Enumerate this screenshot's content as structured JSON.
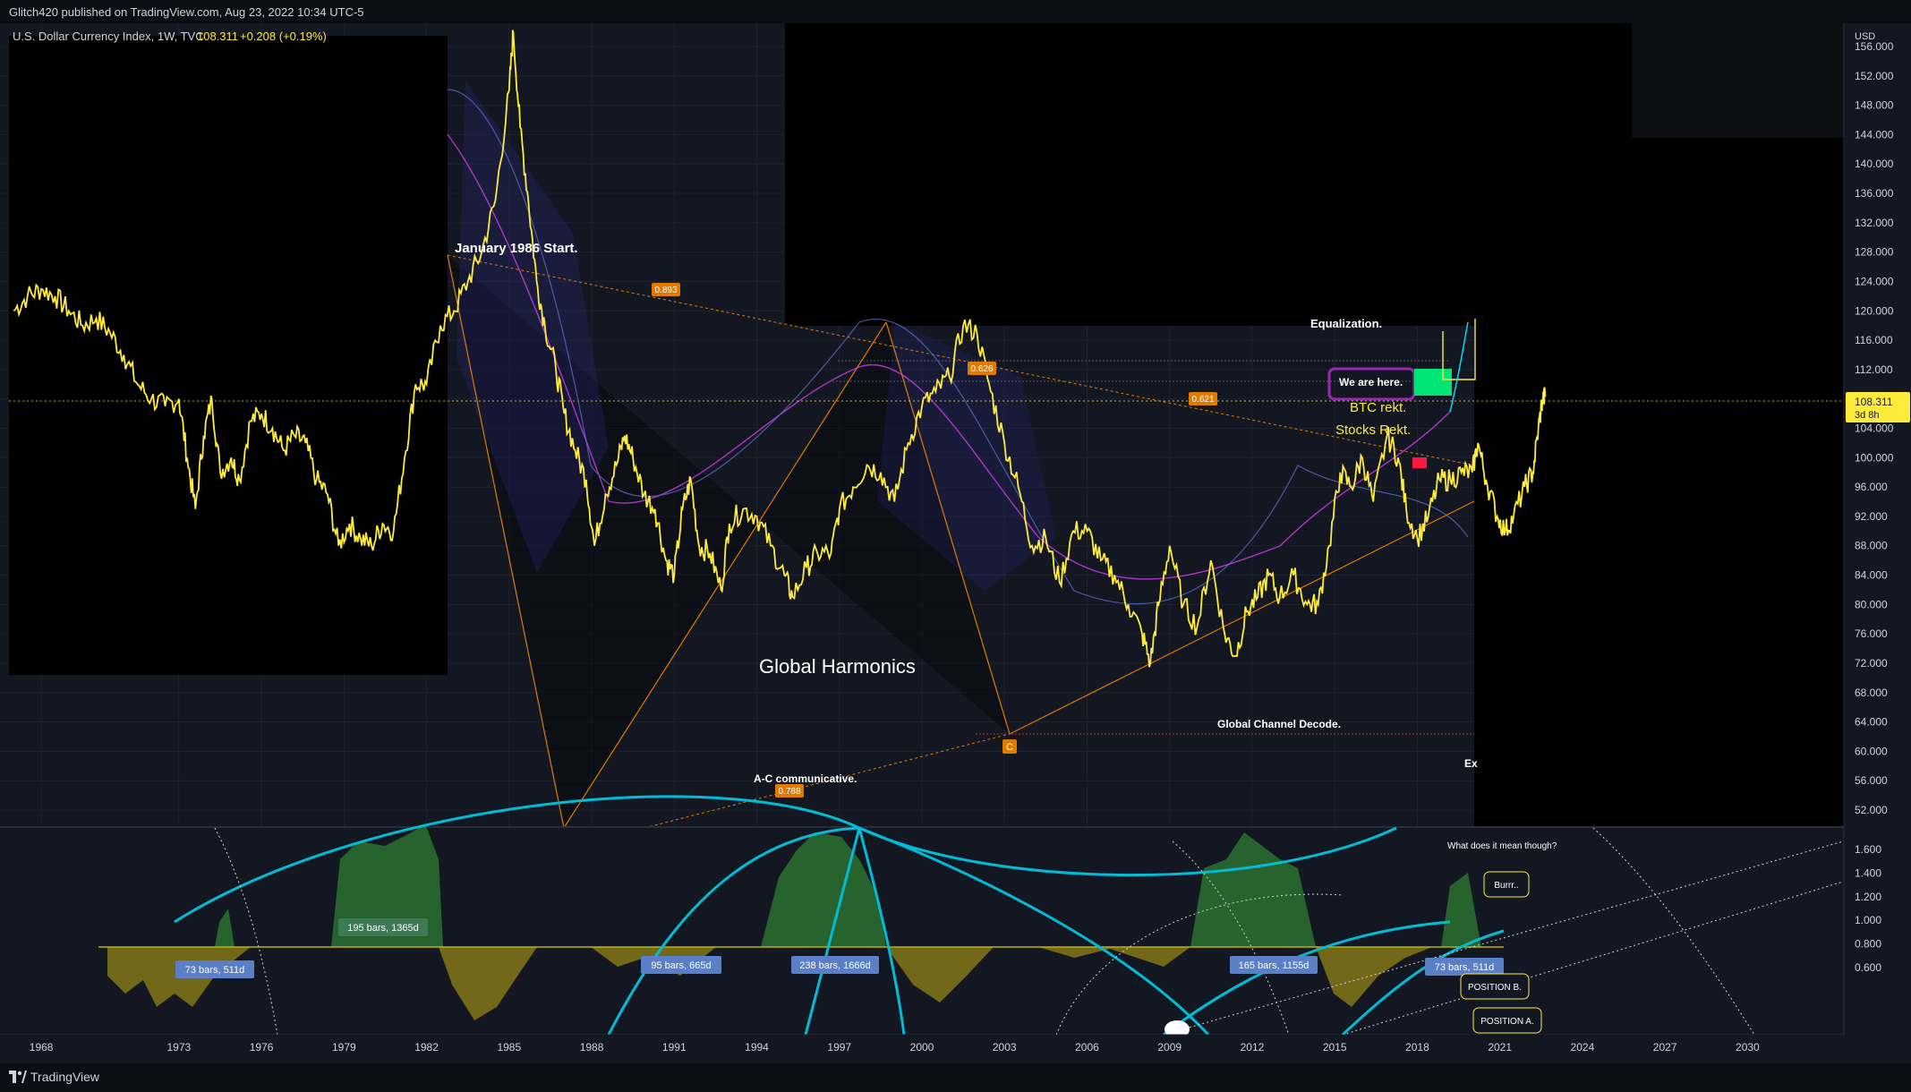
{
  "header": {
    "published": "Glitch420 published on TradingView.com, Aug 23, 2022 10:34 UTC-5"
  },
  "symbol": {
    "name": "U.S. Dollar Currency Index, 1W, TVC",
    "price": "108.311",
    "change": "+0.208 (+0.19%)"
  },
  "price_axis": {
    "unit": "USD",
    "labels": [
      "156.000",
      "152.000",
      "148.000",
      "144.000",
      "140.000",
      "136.000",
      "132.000",
      "128.000",
      "124.000",
      "120.000",
      "116.000",
      "112.000",
      "108.000",
      "104.000",
      "100.000",
      "96.000",
      "92.000",
      "88.000",
      "84.000",
      "80.000",
      "76.000",
      "72.000",
      "68.000",
      "64.000",
      "60.000",
      "56.000",
      "52.000"
    ],
    "current_price": "108.311",
    "countdown": "3d 8h"
  },
  "indicator_axis": {
    "labels": [
      "1.600",
      "1.400",
      "1.200",
      "1.000",
      "0.800",
      "0.600"
    ]
  },
  "time_axis": {
    "labels": [
      "1968",
      "1973",
      "1976",
      "1979",
      "1982",
      "1985",
      "1988",
      "1991",
      "1994",
      "1997",
      "2000",
      "2003",
      "2006",
      "2009",
      "2012",
      "2015",
      "2018",
      "2021",
      "2024",
      "2027",
      "2030"
    ]
  },
  "annotations": {
    "january_start": "January 1986 Start.",
    "equalization": "Equalization.",
    "we_are_here": "We are here.",
    "btc": "BTC rekt.",
    "stocks": "Stocks Rekt.",
    "global_harmonics": "Global Harmonics",
    "global_channel": "Global Channel Decode.",
    "ac_comm": "A-C communicative.",
    "ex": "Ex",
    "what_mean": "What does it mean though?",
    "burrr": "Burrr..",
    "position_b": "POSITION B.",
    "position_a": "POSITION A.",
    "point_c": "C"
  },
  "fib_labels": {
    "f0893": "0.893",
    "f0626": "0.626",
    "f0621": "0.621",
    "f0788": "0.788"
  },
  "bars_labels": {
    "b1": "73 bars, 511d",
    "b2": "195 bars, 1365d",
    "b3": "95 bars, 665d",
    "b4": "238 bars, 1666d",
    "b5": "165 bars, 1155d",
    "b6": "73 bars, 511d"
  },
  "footer": {
    "brand": "TradingView"
  },
  "colors": {
    "price_line": "#ffeb3b",
    "background": "#131722",
    "fib": "#e07b00",
    "current_price_tag": "#ffeb3b",
    "cycle_arc": "#00bcd4",
    "purple_box": "#9c27b0",
    "green_box": "#00e676"
  },
  "chart_data": {
    "type": "line",
    "ylim": [
      50,
      158
    ],
    "x_range": [
      1966.5,
      2033.5
    ],
    "series": [
      {
        "values": [
          [
            1967.0,
            120
          ],
          [
            1967.5,
            122
          ],
          [
            1968.0,
            123
          ],
          [
            1968.5,
            122
          ],
          [
            1969.0,
            120
          ],
          [
            1969.5,
            118
          ],
          [
            1970.0,
            119
          ],
          [
            1970.5,
            117
          ],
          [
            1971.0,
            114
          ],
          [
            1971.5,
            110
          ],
          [
            1972.0,
            108
          ],
          [
            1972.5,
            107
          ],
          [
            1973.0,
            108
          ],
          [
            1973.3,
            100
          ],
          [
            1973.6,
            93
          ],
          [
            1973.9,
            103
          ],
          [
            1974.2,
            108
          ],
          [
            1974.5,
            98
          ],
          [
            1974.9,
            100
          ],
          [
            1975.2,
            97
          ],
          [
            1975.6,
            105
          ],
          [
            1976.0,
            106
          ],
          [
            1976.4,
            104
          ],
          [
            1976.8,
            101
          ],
          [
            1977.2,
            103
          ],
          [
            1977.6,
            102
          ],
          [
            1978.0,
            97
          ],
          [
            1978.4,
            95
          ],
          [
            1978.8,
            88
          ],
          [
            1979.2,
            91
          ],
          [
            1979.6,
            89
          ],
          [
            1980.0,
            88
          ],
          [
            1980.4,
            91
          ],
          [
            1980.8,
            90
          ],
          [
            1981.2,
            100
          ],
          [
            1981.6,
            110
          ],
          [
            1982.0,
            110
          ],
          [
            1982.5,
            118
          ],
          [
            1983.0,
            120
          ],
          [
            1983.5,
            124
          ],
          [
            1984.0,
            128
          ],
          [
            1984.5,
            135
          ],
          [
            1985.0,
            150
          ],
          [
            1985.15,
            158
          ],
          [
            1985.4,
            145
          ],
          [
            1985.7,
            135
          ],
          [
            1986.0,
            124
          ],
          [
            1986.3,
            118
          ],
          [
            1986.7,
            112
          ],
          [
            1987.0,
            106
          ],
          [
            1987.4,
            101
          ],
          [
            1987.8,
            97
          ],
          [
            1988.1,
            88
          ],
          [
            1988.5,
            95
          ],
          [
            1988.9,
            99
          ],
          [
            1989.2,
            103
          ],
          [
            1989.5,
            100
          ],
          [
            1989.9,
            95
          ],
          [
            1990.3,
            93
          ],
          [
            1990.7,
            86
          ],
          [
            1991.0,
            84
          ],
          [
            1991.3,
            93
          ],
          [
            1991.6,
            97
          ],
          [
            1991.9,
            88
          ],
          [
            1992.3,
            87
          ],
          [
            1992.7,
            82
          ],
          [
            1993.0,
            91
          ],
          [
            1993.5,
            93
          ],
          [
            1994.0,
            92
          ],
          [
            1994.5,
            88
          ],
          [
            1995.0,
            84
          ],
          [
            1995.3,
            81
          ],
          [
            1995.8,
            85
          ],
          [
            1996.2,
            87
          ],
          [
            1996.7,
            87
          ],
          [
            1997.0,
            93
          ],
          [
            1997.5,
            96
          ],
          [
            1998.0,
            99
          ],
          [
            1998.5,
            98
          ],
          [
            1999.0,
            94
          ],
          [
            1999.5,
            102
          ],
          [
            2000.0,
            107
          ],
          [
            2000.5,
            109
          ],
          [
            2001.0,
            111
          ],
          [
            2001.5,
            118
          ],
          [
            2002.0,
            117
          ],
          [
            2002.5,
            109
          ],
          [
            2003.0,
            102
          ],
          [
            2003.5,
            96
          ],
          [
            2004.0,
            88
          ],
          [
            2004.5,
            89
          ],
          [
            2005.0,
            83
          ],
          [
            2005.5,
            90
          ],
          [
            2006.0,
            90
          ],
          [
            2006.5,
            86
          ],
          [
            2007.0,
            84
          ],
          [
            2007.5,
            80
          ],
          [
            2008.0,
            76
          ],
          [
            2008.3,
            72
          ],
          [
            2008.6,
            80
          ],
          [
            2009.0,
            88
          ],
          [
            2009.5,
            80
          ],
          [
            2010.0,
            77
          ],
          [
            2010.5,
            86
          ],
          [
            2011.0,
            76
          ],
          [
            2011.4,
            73
          ],
          [
            2011.8,
            79
          ],
          [
            2012.2,
            81
          ],
          [
            2012.6,
            84
          ],
          [
            2013.0,
            81
          ],
          [
            2013.5,
            84
          ],
          [
            2014.0,
            80
          ],
          [
            2014.4,
            80
          ],
          [
            2014.8,
            88
          ],
          [
            2015.2,
            98
          ],
          [
            2015.6,
            96
          ],
          [
            2016.0,
            100
          ],
          [
            2016.4,
            94
          ],
          [
            2016.9,
            103
          ],
          [
            2017.3,
            100
          ],
          [
            2017.6,
            93
          ],
          [
            2018.0,
            89
          ],
          [
            2018.4,
            92
          ],
          [
            2018.8,
            97
          ],
          [
            2019.2,
            97
          ],
          [
            2019.6,
            98
          ],
          [
            2020.0,
            98
          ],
          [
            2020.2,
            102
          ],
          [
            2020.5,
            97
          ],
          [
            2020.9,
            92
          ],
          [
            2021.2,
            90
          ],
          [
            2021.5,
            92
          ],
          [
            2021.9,
            96
          ],
          [
            2022.2,
            98
          ],
          [
            2022.4,
            104
          ],
          [
            2022.55,
            108
          ],
          [
            2022.65,
            108.3
          ]
        ]
      }
    ]
  }
}
